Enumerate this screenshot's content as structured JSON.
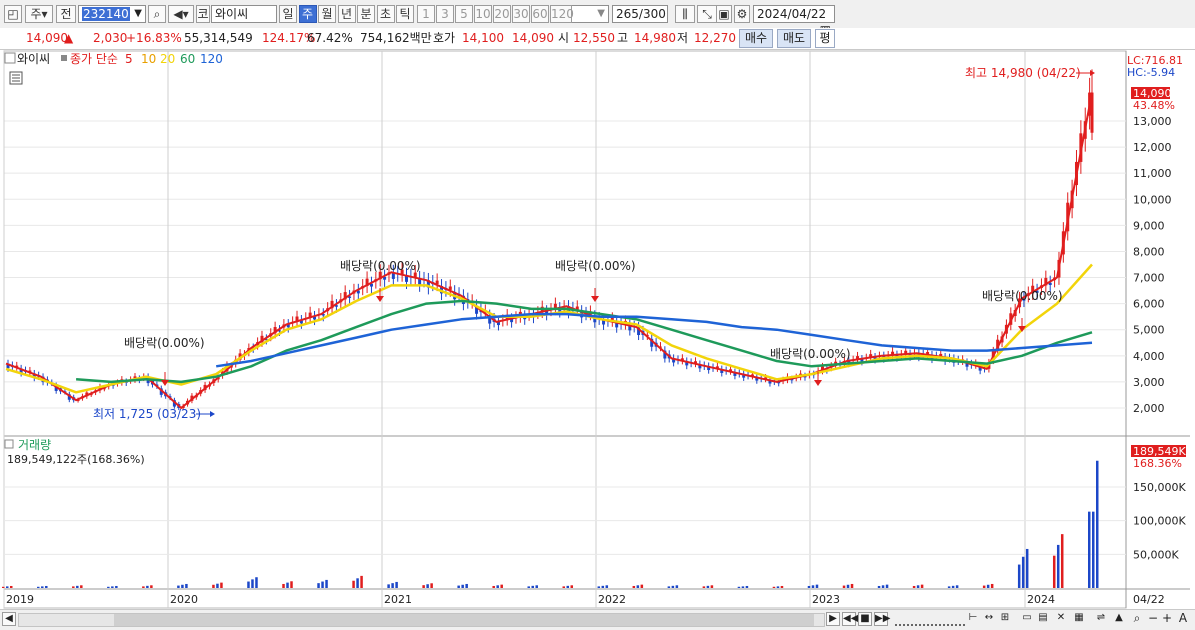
{
  "toolbar": {
    "market_type": "주",
    "prev_label": "전",
    "code": "232140",
    "stock_prefix": "코",
    "stock_name": "와이씨",
    "periods": [
      "일",
      "주",
      "월",
      "년",
      "분",
      "초",
      "틱"
    ],
    "selected_period": "주",
    "intervals": [
      "1",
      "3",
      "5",
      "10",
      "20",
      "30",
      "60",
      "120"
    ],
    "count": "265",
    "count_total": "/300",
    "date": "2024/04/22"
  },
  "quote": {
    "price": "14,090",
    "change_arrow": "▲",
    "change": "2,030",
    "change_pct": "+16.83%",
    "volume": "55,314,549",
    "vol_ratio": "124.17%",
    "turnover": "67.42%",
    "amount": "754,162백만",
    "ask_label": "호가",
    "ask1": "14,100",
    "ask2": "14,090",
    "open_label": "시",
    "open": "12,550",
    "high_label": "고",
    "high": "14,980",
    "low_label": "저",
    "low": "12,270",
    "buy_label": "매수",
    "sell_label": "매도",
    "flat_label": "평"
  },
  "legend": {
    "stock": "와이씨",
    "ma_title": "종가 단순",
    "ma_periods": [
      "5",
      "10",
      "20",
      "60",
      "120"
    ],
    "ma_colors": [
      "#e01e1e",
      "#e8a000",
      "#f2d40a",
      "#1e9a5a",
      "#1e63d6"
    ]
  },
  "price_axis": {
    "lc": "LC:716.81",
    "hc": "HC:-5.94",
    "current": "14,090",
    "current_pct": "43.48%",
    "ticks": [
      "13,000",
      "12,000",
      "11,000",
      "10,000",
      "9,000",
      "8,000",
      "7,000",
      "6,000",
      "5,000",
      "4,000",
      "3,000",
      "2,000"
    ]
  },
  "annotations": {
    "high": "최고 14,980 (04/22)",
    "low": "최저 1,725 (03/23)",
    "dividends": [
      "배당락(0.00%)",
      "배당락(0.00%)",
      "배당락(0.00%)",
      "배당락(0.00%)",
      "배당락(0.00%)"
    ]
  },
  "volume_panel": {
    "title": "거래량",
    "value": "189,549,122주(168.36%)",
    "current": "189,549K",
    "current_pct": "168.36%",
    "ticks": [
      "150,000K",
      "100,000K",
      "50,000K"
    ]
  },
  "x_axis": {
    "labels": [
      "2019",
      "2020",
      "2021",
      "2022",
      "2023",
      "2024"
    ],
    "last_date": "04/22"
  },
  "chart_data": {
    "type": "line",
    "title": "",
    "xlabel": "",
    "ylabel": "",
    "x": [
      "2019-01",
      "2019-04",
      "2019-07",
      "2019-10",
      "2020-01",
      "2020-03",
      "2020-05",
      "2020-07",
      "2020-09",
      "2020-11",
      "2021-01",
      "2021-03",
      "2021-05",
      "2021-07",
      "2021-09",
      "2021-11",
      "2022-01",
      "2022-03",
      "2022-05",
      "2022-07",
      "2022-09",
      "2022-11",
      "2023-01",
      "2023-03",
      "2023-05",
      "2023-07",
      "2023-09",
      "2023-11",
      "2024-01",
      "2024-02",
      "2024-03",
      "2024-04"
    ],
    "series": [
      {
        "name": "5",
        "values": [
          3700,
          3200,
          2300,
          2900,
          3200,
          2000,
          3100,
          4300,
          5200,
          5600,
          6500,
          7200,
          6900,
          6300,
          5300,
          5600,
          5900,
          5400,
          5100,
          3900,
          3600,
          3300,
          3000,
          3300,
          3800,
          4000,
          4100,
          3900,
          3500,
          6200,
          7000,
          14090
        ]
      },
      {
        "name": "20",
        "values": [
          3500,
          3100,
          2600,
          2900,
          3200,
          2900,
          3300,
          4200,
          5000,
          5400,
          6100,
          6700,
          6700,
          6200,
          5500,
          5500,
          5700,
          5400,
          5200,
          4400,
          3900,
          3500,
          3100,
          3300,
          3600,
          3900,
          4000,
          3900,
          3600,
          5000,
          6000,
          7500
        ]
      },
      {
        "name": "60",
        "values": [
          null,
          null,
          3100,
          3000,
          3100,
          3000,
          3200,
          3600,
          4200,
          4600,
          5100,
          5600,
          6000,
          6100,
          6000,
          5800,
          5800,
          5600,
          5400,
          5000,
          4600,
          4200,
          3800,
          3600,
          3700,
          3800,
          3900,
          3800,
          3700,
          4000,
          4500,
          4900
        ]
      },
      {
        "name": "120",
        "values": [
          null,
          null,
          null,
          null,
          null,
          null,
          3600,
          3800,
          4100,
          4400,
          4700,
          5000,
          5200,
          5400,
          5500,
          5600,
          5600,
          5500,
          5500,
          5400,
          5300,
          5100,
          5000,
          4800,
          4600,
          4400,
          4300,
          4200,
          4200,
          4300,
          4400,
          4500
        ]
      }
    ],
    "volume": [
      3,
      3,
      4,
      3,
      4,
      6,
      8,
      16,
      10,
      12,
      18,
      9,
      7,
      6,
      5,
      4,
      4,
      4,
      5,
      4,
      4,
      3,
      3,
      5,
      6,
      5,
      5,
      4,
      6,
      58,
      80,
      189
    ],
    "ylim": [
      1500,
      15000
    ],
    "high": 14980,
    "low": 1725
  }
}
